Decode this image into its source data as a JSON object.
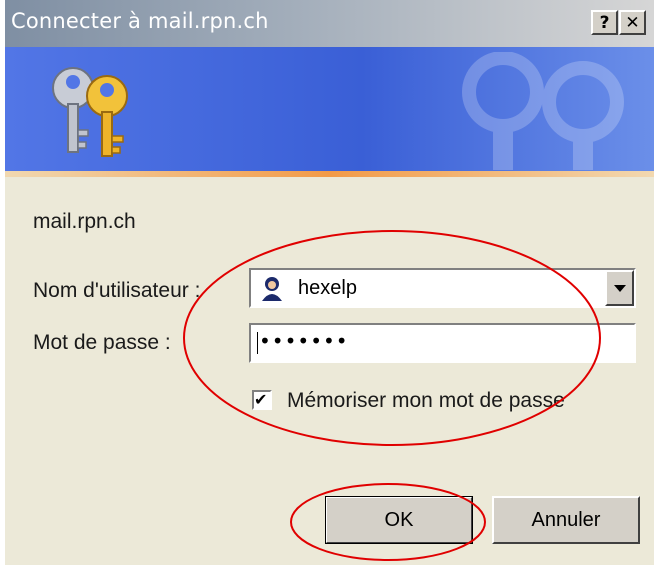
{
  "window": {
    "title": "Connecter à mail.rpn.ch",
    "help_button": "?",
    "close_button": "✕"
  },
  "dialog": {
    "server": "mail.rpn.ch",
    "username_label": "Nom d'utilisateur :",
    "username_value": "hexelp",
    "password_label": "Mot de passe :",
    "password_value": "•••••••",
    "remember_label": "Mémoriser mon mot de passe",
    "remember_checked": true
  },
  "buttons": {
    "ok": "OK",
    "cancel": "Annuler"
  },
  "colors": {
    "title_gradient_start": "#7f8fa3",
    "banner_blue": "#3a5fd6",
    "banner_stripe_orange": "#f29a47",
    "dialog_bg": "#ece9d8",
    "annotation_red": "#e00000"
  },
  "icons": [
    "keys-icon",
    "user-icon",
    "dropdown-arrow-icon",
    "checkmark-icon"
  ]
}
